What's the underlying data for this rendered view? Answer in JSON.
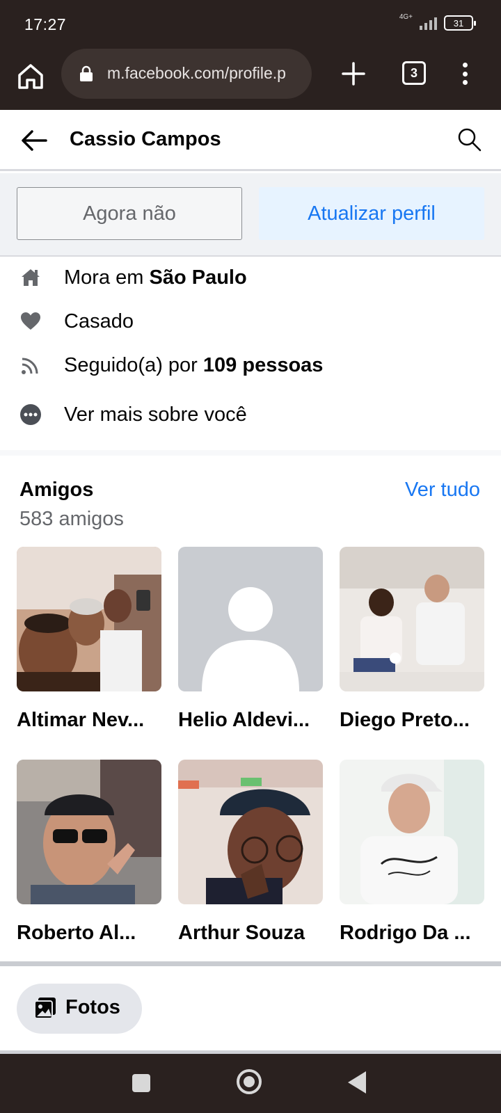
{
  "status_bar": {
    "time": "17:27",
    "network": "4G+",
    "battery": "31"
  },
  "browser": {
    "url": "m.facebook.com/profile.p",
    "tab_count": "3"
  },
  "header": {
    "title": "Cassio Campos"
  },
  "actions": {
    "not_now": "Agora não",
    "update_profile": "Atualizar perfil"
  },
  "info": {
    "lives_prefix": "Mora em ",
    "lives_city": "São Paulo",
    "relationship": "Casado",
    "followed_prefix": "Seguido(a) por ",
    "followed_count": "109 pessoas",
    "see_more": "Ver mais sobre você"
  },
  "friends": {
    "title": "Amigos",
    "count": "583 amigos",
    "see_all": "Ver tudo",
    "items": [
      {
        "name": "Altimar Nev..."
      },
      {
        "name": "Helio Aldevi..."
      },
      {
        "name": "Diego Preto..."
      },
      {
        "name": "Roberto Al..."
      },
      {
        "name": "Arthur Souza"
      },
      {
        "name": "Rodrigo Da ..."
      }
    ]
  },
  "photos": {
    "label": "Fotos"
  },
  "colors": {
    "accent": "#1877f2",
    "chrome": "#2a211f",
    "secondary_text": "#65676b"
  }
}
